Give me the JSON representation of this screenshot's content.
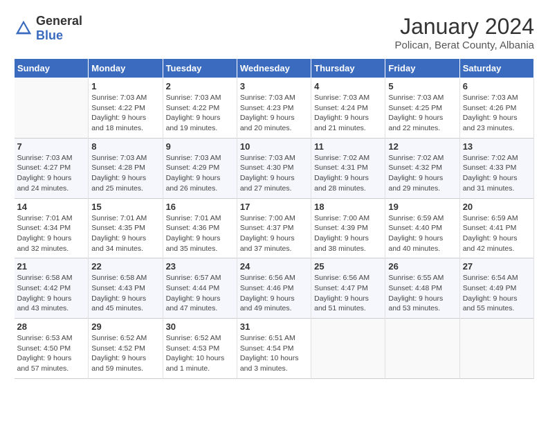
{
  "header": {
    "logo_general": "General",
    "logo_blue": "Blue",
    "month_title": "January 2024",
    "subtitle": "Polican, Berat County, Albania"
  },
  "weekdays": [
    "Sunday",
    "Monday",
    "Tuesday",
    "Wednesday",
    "Thursday",
    "Friday",
    "Saturday"
  ],
  "weeks": [
    [
      {
        "day": "",
        "sunrise": "",
        "sunset": "",
        "daylight": "",
        "empty": true
      },
      {
        "day": "1",
        "sunrise": "Sunrise: 7:03 AM",
        "sunset": "Sunset: 4:22 PM",
        "daylight": "Daylight: 9 hours and 18 minutes."
      },
      {
        "day": "2",
        "sunrise": "Sunrise: 7:03 AM",
        "sunset": "Sunset: 4:22 PM",
        "daylight": "Daylight: 9 hours and 19 minutes."
      },
      {
        "day": "3",
        "sunrise": "Sunrise: 7:03 AM",
        "sunset": "Sunset: 4:23 PM",
        "daylight": "Daylight: 9 hours and 20 minutes."
      },
      {
        "day": "4",
        "sunrise": "Sunrise: 7:03 AM",
        "sunset": "Sunset: 4:24 PM",
        "daylight": "Daylight: 9 hours and 21 minutes."
      },
      {
        "day": "5",
        "sunrise": "Sunrise: 7:03 AM",
        "sunset": "Sunset: 4:25 PM",
        "daylight": "Daylight: 9 hours and 22 minutes."
      },
      {
        "day": "6",
        "sunrise": "Sunrise: 7:03 AM",
        "sunset": "Sunset: 4:26 PM",
        "daylight": "Daylight: 9 hours and 23 minutes."
      }
    ],
    [
      {
        "day": "7",
        "sunrise": "Sunrise: 7:03 AM",
        "sunset": "Sunset: 4:27 PM",
        "daylight": "Daylight: 9 hours and 24 minutes."
      },
      {
        "day": "8",
        "sunrise": "Sunrise: 7:03 AM",
        "sunset": "Sunset: 4:28 PM",
        "daylight": "Daylight: 9 hours and 25 minutes."
      },
      {
        "day": "9",
        "sunrise": "Sunrise: 7:03 AM",
        "sunset": "Sunset: 4:29 PM",
        "daylight": "Daylight: 9 hours and 26 minutes."
      },
      {
        "day": "10",
        "sunrise": "Sunrise: 7:03 AM",
        "sunset": "Sunset: 4:30 PM",
        "daylight": "Daylight: 9 hours and 27 minutes."
      },
      {
        "day": "11",
        "sunrise": "Sunrise: 7:02 AM",
        "sunset": "Sunset: 4:31 PM",
        "daylight": "Daylight: 9 hours and 28 minutes."
      },
      {
        "day": "12",
        "sunrise": "Sunrise: 7:02 AM",
        "sunset": "Sunset: 4:32 PM",
        "daylight": "Daylight: 9 hours and 29 minutes."
      },
      {
        "day": "13",
        "sunrise": "Sunrise: 7:02 AM",
        "sunset": "Sunset: 4:33 PM",
        "daylight": "Daylight: 9 hours and 31 minutes."
      }
    ],
    [
      {
        "day": "14",
        "sunrise": "Sunrise: 7:01 AM",
        "sunset": "Sunset: 4:34 PM",
        "daylight": "Daylight: 9 hours and 32 minutes."
      },
      {
        "day": "15",
        "sunrise": "Sunrise: 7:01 AM",
        "sunset": "Sunset: 4:35 PM",
        "daylight": "Daylight: 9 hours and 34 minutes."
      },
      {
        "day": "16",
        "sunrise": "Sunrise: 7:01 AM",
        "sunset": "Sunset: 4:36 PM",
        "daylight": "Daylight: 9 hours and 35 minutes."
      },
      {
        "day": "17",
        "sunrise": "Sunrise: 7:00 AM",
        "sunset": "Sunset: 4:37 PM",
        "daylight": "Daylight: 9 hours and 37 minutes."
      },
      {
        "day": "18",
        "sunrise": "Sunrise: 7:00 AM",
        "sunset": "Sunset: 4:39 PM",
        "daylight": "Daylight: 9 hours and 38 minutes."
      },
      {
        "day": "19",
        "sunrise": "Sunrise: 6:59 AM",
        "sunset": "Sunset: 4:40 PM",
        "daylight": "Daylight: 9 hours and 40 minutes."
      },
      {
        "day": "20",
        "sunrise": "Sunrise: 6:59 AM",
        "sunset": "Sunset: 4:41 PM",
        "daylight": "Daylight: 9 hours and 42 minutes."
      }
    ],
    [
      {
        "day": "21",
        "sunrise": "Sunrise: 6:58 AM",
        "sunset": "Sunset: 4:42 PM",
        "daylight": "Daylight: 9 hours and 43 minutes."
      },
      {
        "day": "22",
        "sunrise": "Sunrise: 6:58 AM",
        "sunset": "Sunset: 4:43 PM",
        "daylight": "Daylight: 9 hours and 45 minutes."
      },
      {
        "day": "23",
        "sunrise": "Sunrise: 6:57 AM",
        "sunset": "Sunset: 4:44 PM",
        "daylight": "Daylight: 9 hours and 47 minutes."
      },
      {
        "day": "24",
        "sunrise": "Sunrise: 6:56 AM",
        "sunset": "Sunset: 4:46 PM",
        "daylight": "Daylight: 9 hours and 49 minutes."
      },
      {
        "day": "25",
        "sunrise": "Sunrise: 6:56 AM",
        "sunset": "Sunset: 4:47 PM",
        "daylight": "Daylight: 9 hours and 51 minutes."
      },
      {
        "day": "26",
        "sunrise": "Sunrise: 6:55 AM",
        "sunset": "Sunset: 4:48 PM",
        "daylight": "Daylight: 9 hours and 53 minutes."
      },
      {
        "day": "27",
        "sunrise": "Sunrise: 6:54 AM",
        "sunset": "Sunset: 4:49 PM",
        "daylight": "Daylight: 9 hours and 55 minutes."
      }
    ],
    [
      {
        "day": "28",
        "sunrise": "Sunrise: 6:53 AM",
        "sunset": "Sunset: 4:50 PM",
        "daylight": "Daylight: 9 hours and 57 minutes."
      },
      {
        "day": "29",
        "sunrise": "Sunrise: 6:52 AM",
        "sunset": "Sunset: 4:52 PM",
        "daylight": "Daylight: 9 hours and 59 minutes."
      },
      {
        "day": "30",
        "sunrise": "Sunrise: 6:52 AM",
        "sunset": "Sunset: 4:53 PM",
        "daylight": "Daylight: 10 hours and 1 minute."
      },
      {
        "day": "31",
        "sunrise": "Sunrise: 6:51 AM",
        "sunset": "Sunset: 4:54 PM",
        "daylight": "Daylight: 10 hours and 3 minutes."
      },
      {
        "day": "",
        "sunrise": "",
        "sunset": "",
        "daylight": "",
        "empty": true
      },
      {
        "day": "",
        "sunrise": "",
        "sunset": "",
        "daylight": "",
        "empty": true
      },
      {
        "day": "",
        "sunrise": "",
        "sunset": "",
        "daylight": "",
        "empty": true
      }
    ]
  ]
}
